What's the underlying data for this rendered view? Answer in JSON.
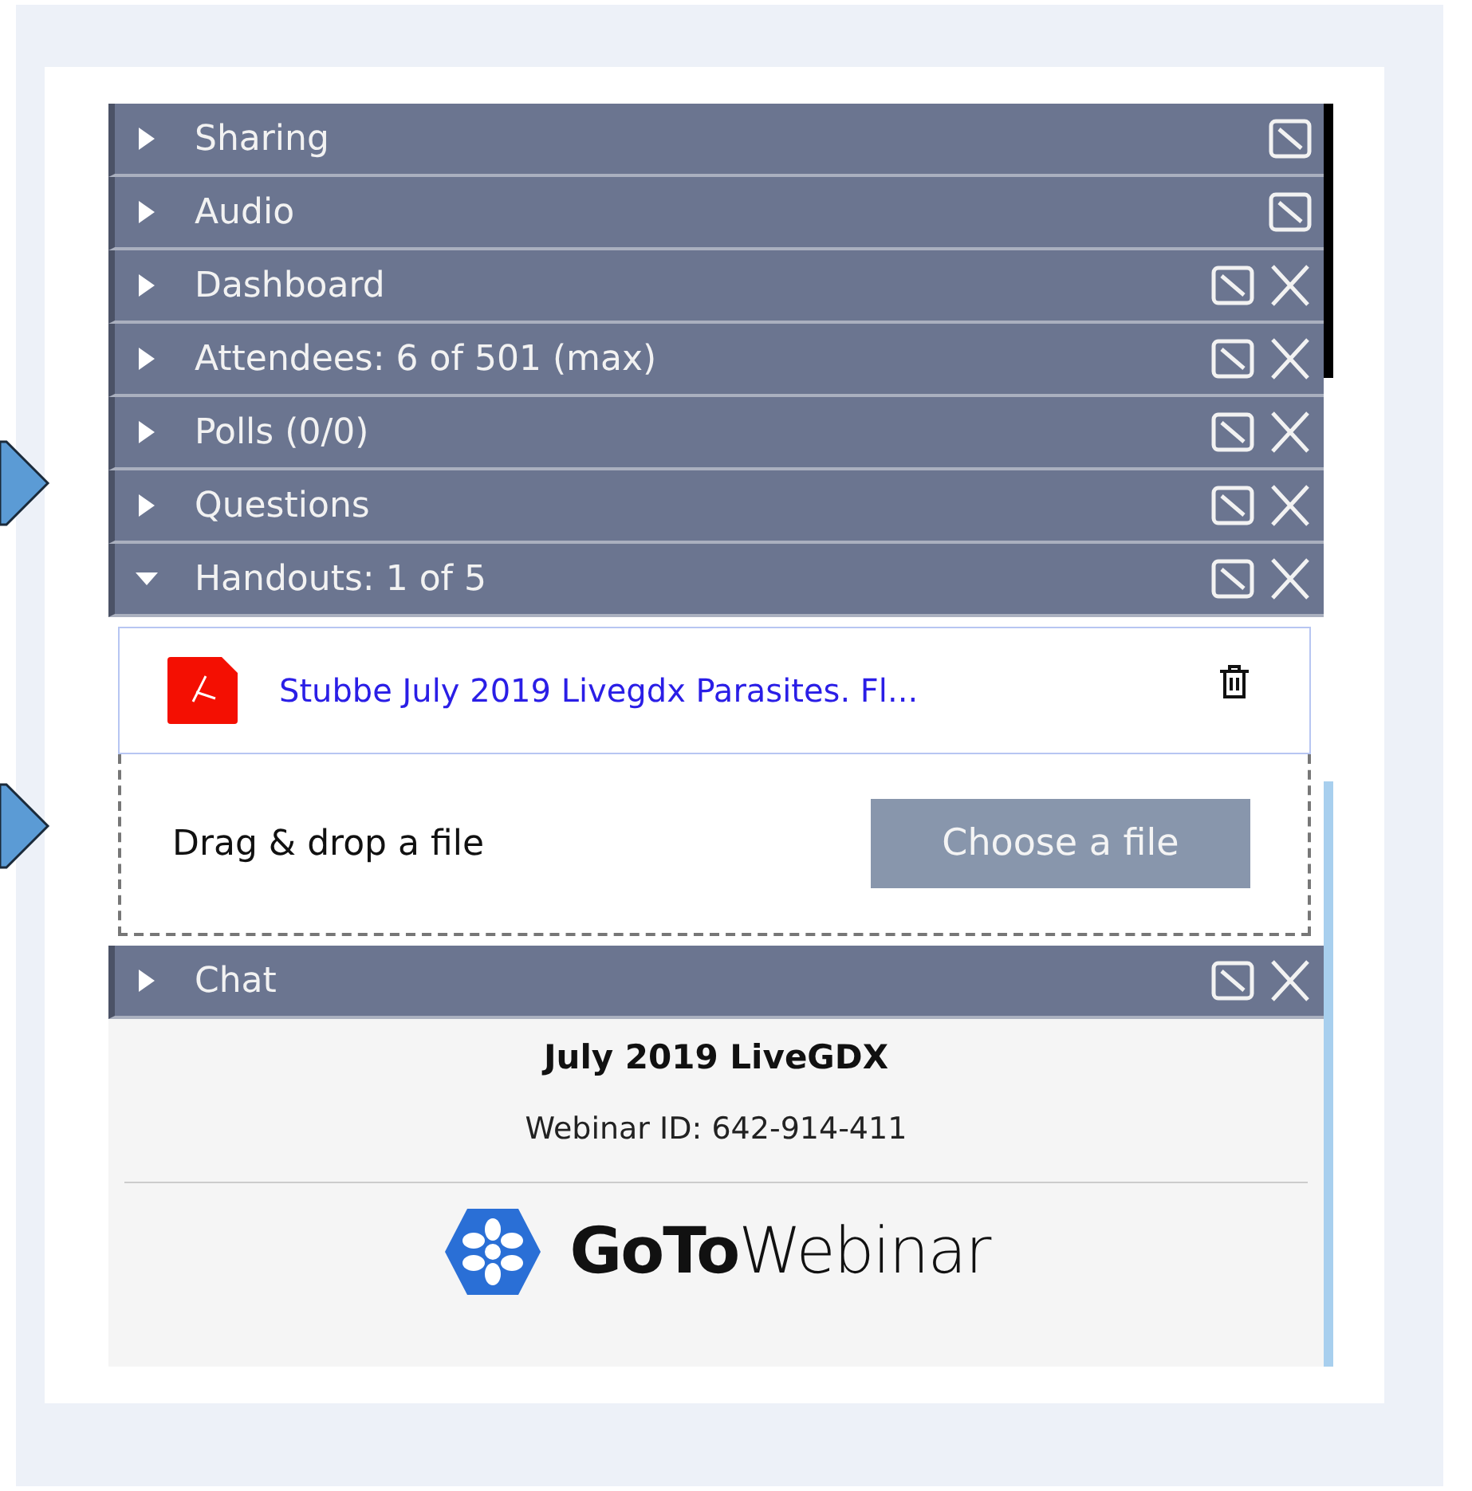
{
  "panels": [
    {
      "label": "Sharing",
      "expanded": false,
      "closable": false
    },
    {
      "label": "Audio",
      "expanded": false,
      "closable": false
    },
    {
      "label": "Dashboard",
      "expanded": false,
      "closable": true
    },
    {
      "label": "Attendees:  6 of 501 (max)",
      "expanded": false,
      "closable": true
    },
    {
      "label": "Polls (0/0)",
      "expanded": false,
      "closable": true
    },
    {
      "label": "Questions",
      "expanded": false,
      "closable": true
    },
    {
      "label": "Handouts: 1 of 5",
      "expanded": true,
      "closable": true,
      "files": [
        {
          "name": "Stubbe July 2019 Livegdx Parasites. Fl..."
        }
      ],
      "dropzone": {
        "text": "Drag & drop a file",
        "button": "Choose a file"
      }
    },
    {
      "label": "Chat",
      "expanded": false,
      "closable": true
    }
  ],
  "footer": {
    "title": "July 2019 LiveGDX",
    "webinar_id": "Webinar ID: 642-914-411",
    "logo": {
      "bold": "GoTo",
      "light": "Webinar"
    }
  }
}
